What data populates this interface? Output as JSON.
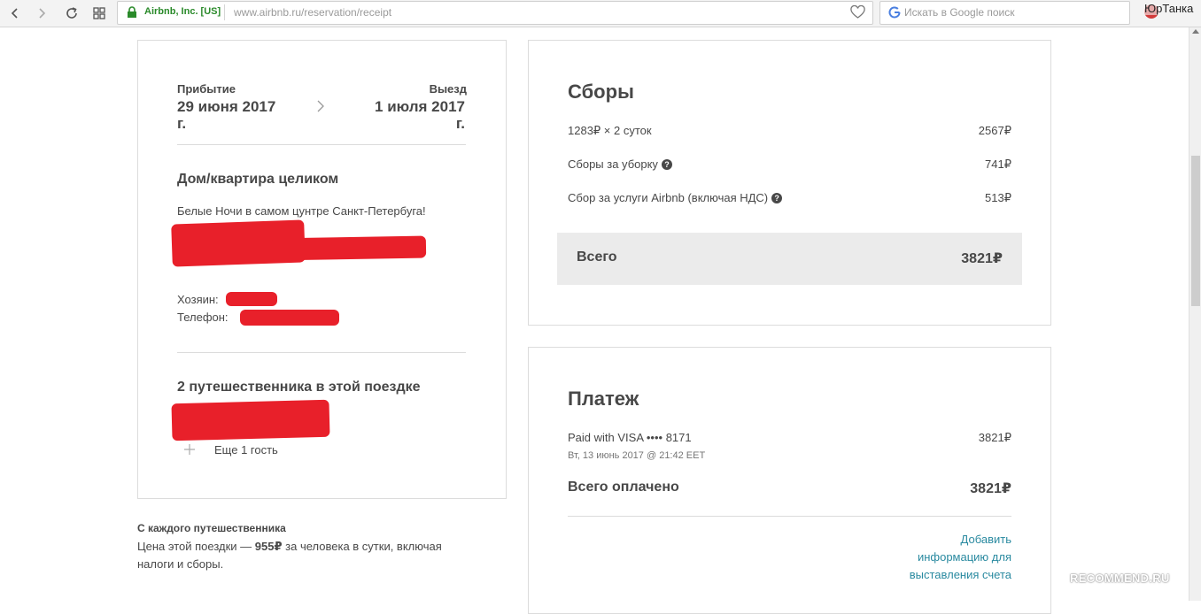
{
  "browser": {
    "site_identity": "Airbnb, Inc. [US]",
    "url": "www.airbnb.ru/reservation/receipt",
    "search_placeholder": "Искать в Google поиск",
    "user_name": "ЮрТанка"
  },
  "trip": {
    "checkin_label": "Прибытие",
    "checkin_date_line1": "29 июня 2017",
    "checkin_date_line2": "г.",
    "checkout_label": "Выезд",
    "checkout_date_line1": "1 июля 2017",
    "checkout_date_line2": "г.",
    "listing_type": "Дом/квартира целиком",
    "listing_title": "Белые Ночи в самом цунтре Санкт-Петербуга!",
    "host_label": "Хозяин:",
    "phone_label": "Телефон:",
    "guests_heading": "2 путешественника в этой поездке",
    "extra_guest": "Еще 1 гость"
  },
  "per_traveler": {
    "title": "С каждого путешественника",
    "text_before": "Цена этой поездки — ",
    "price": "955₽",
    "text_after": " за человека в сутки, включая",
    "text_line2": "налоги и сборы."
  },
  "fees": {
    "title": "Сборы",
    "rows": [
      {
        "label": "1283₽ × 2 суток",
        "value": "2567₽"
      },
      {
        "label": "Сборы за уборку",
        "value": "741₽"
      },
      {
        "label": "Сбор за услуги Airbnb (включая НДС)",
        "value": "513₽"
      }
    ],
    "total_label": "Всего",
    "total_value": "3821₽"
  },
  "payment": {
    "title": "Платеж",
    "method": "Paid with VISA •••• 8171",
    "method_amount": "3821₽",
    "timestamp": "Вт, 13 июнь 2017 @ 21:42 EET",
    "total_label": "Всего оплачено",
    "total_value": "3821₽",
    "billing_link_line1": "Добавить",
    "billing_link_line2": "информацию для",
    "billing_link_line3": "выставления счета"
  },
  "watermark": "RECOMMEND.RU",
  "colors": {
    "text": "#484848",
    "link": "#2a8aa0",
    "redaction": "#e8202a",
    "total_bar": "#ebebeb"
  }
}
